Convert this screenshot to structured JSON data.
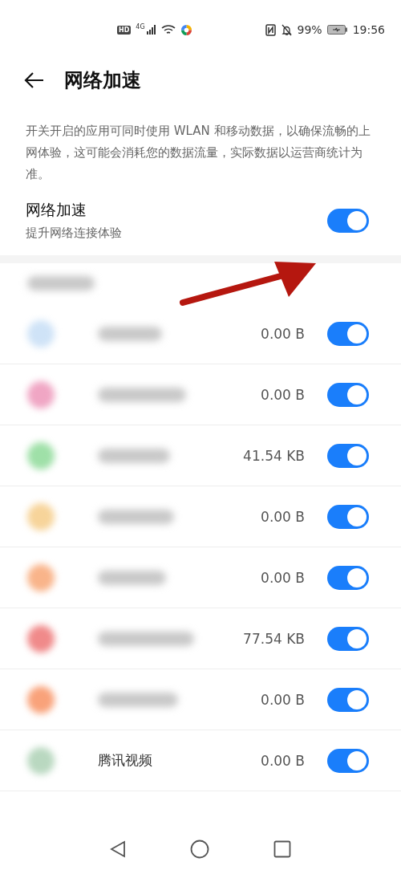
{
  "status_bar": {
    "hd": "HD",
    "network": "4G",
    "battery": "99%",
    "time": "19:56"
  },
  "header": {
    "title": "网络加速"
  },
  "description": "开关开启的应用可同时使用 WLAN 和移动数据，以确保流畅的上网体验，这可能会消耗您的数据流量，实际数据以运营商统计为准。",
  "main_toggle": {
    "title": "网络加速",
    "subtitle": "提升网络连接体验",
    "on": true
  },
  "apps": [
    {
      "color": "#cfe3f7",
      "usage": "0.00 B",
      "on": true
    },
    {
      "color": "#f0a6c4",
      "usage": "0.00 B",
      "on": true
    },
    {
      "color": "#9fe0a8",
      "usage": "41.54 KB",
      "on": true
    },
    {
      "color": "#f7d49a",
      "usage": "0.00 B",
      "on": true
    },
    {
      "color": "#f9b48a",
      "usage": "0.00 B",
      "on": true
    },
    {
      "color": "#f08a8a",
      "usage": "77.54 KB",
      "on": true
    },
    {
      "color": "#f9a27a",
      "usage": "0.00 B",
      "on": true
    },
    {
      "color": "#b9d8c0",
      "name": "腾讯视频",
      "usage": "0.00 B",
      "on": true
    }
  ]
}
